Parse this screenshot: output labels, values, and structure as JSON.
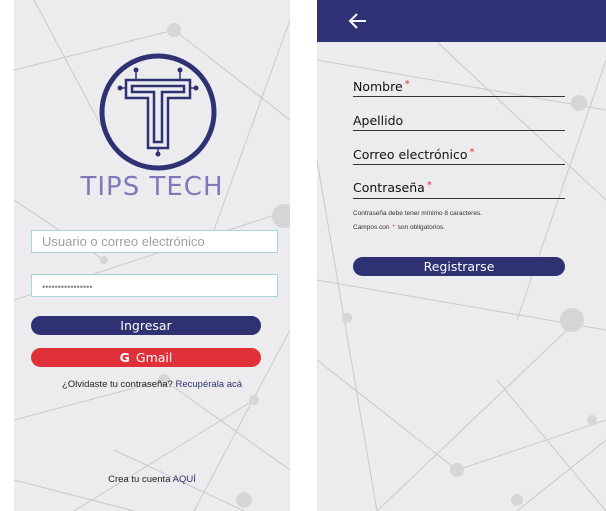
{
  "login": {
    "brand": "TIPS TECH",
    "username_placeholder": "Usuario o correo electrónico",
    "password_value": "••••••••••••••••",
    "login_button": "Ingresar",
    "gmail_icon": "G",
    "gmail_button": "Gmail",
    "forgot_text": "¿Olvidaste tu contraseña?",
    "forgot_link": "Recupérala acá",
    "create_text": "Crea tu cuenta",
    "create_link": "AQUÍ"
  },
  "register": {
    "back_icon": "arrow-left-icon",
    "fields": [
      {
        "label": "Nombre",
        "required_mark": "*"
      },
      {
        "label": "Apellido"
      },
      {
        "label": "Correo electrónico",
        "required_mark": "*"
      },
      {
        "label": "Contraseña",
        "required_mark": "*"
      }
    ],
    "note_password": "Contraseña debe tener mínimo 8 caracteres.",
    "note_required_before": "Campos con",
    "note_required_mark": "*",
    "note_required_after": "son obligatorios.",
    "submit_button": "Registrarse"
  },
  "colors": {
    "primary": "#2e3172",
    "gmail": "#e0303a",
    "brand_text": "#7e79b8",
    "input_border": "#a9d6de"
  }
}
